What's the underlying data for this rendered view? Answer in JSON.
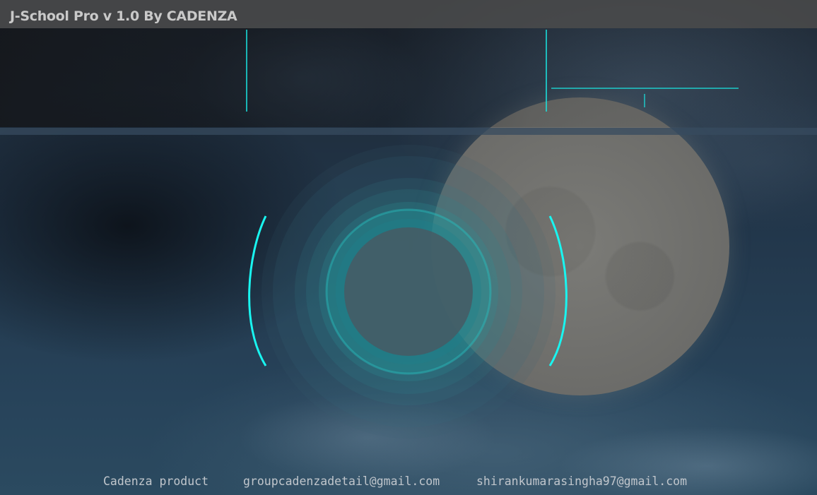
{
  "window": {
    "title": "J-School Pro v 1.0 By CADENZA"
  },
  "footer": {
    "product": "Cadenza product",
    "email_group": "groupcadenzadetail@gmail.com",
    "email_personal": "shirankumarasingha97@gmail.com"
  },
  "theme": {
    "accent": "#19f5f0",
    "titlebar": "#4b4b4b",
    "text": "#c9c9c9"
  },
  "loader": {
    "state": "idle"
  }
}
